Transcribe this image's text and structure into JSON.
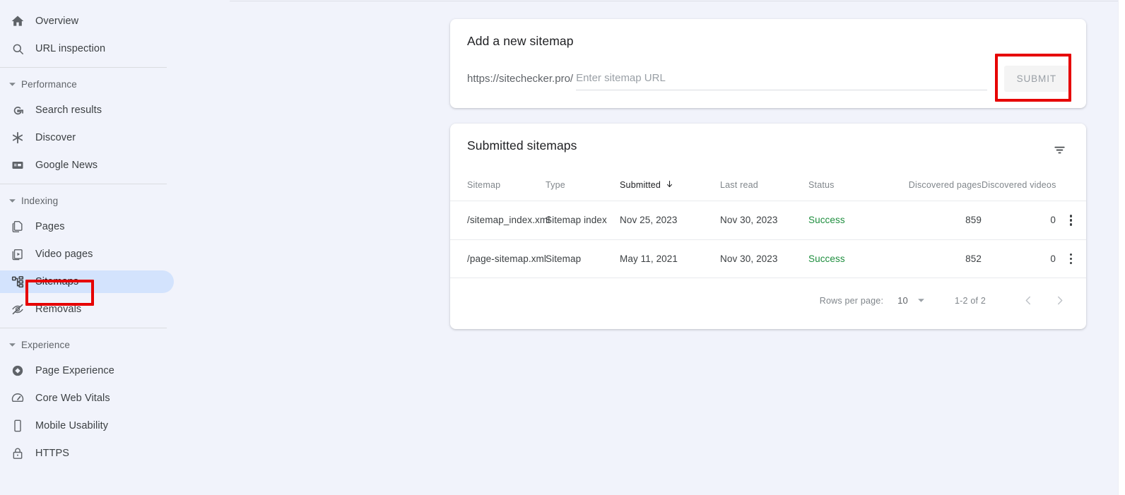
{
  "sidebar": {
    "top_items": [
      {
        "label": "Overview",
        "icon": "home-icon",
        "id": "overview"
      },
      {
        "label": "URL inspection",
        "icon": "search-icon",
        "id": "url-inspection"
      }
    ],
    "groups": [
      {
        "label": "Performance",
        "caret": "chevron-down-icon",
        "items": [
          {
            "label": "Search results",
            "icon": "google-g-icon",
            "id": "search-results"
          },
          {
            "label": "Discover",
            "icon": "asterisk-icon",
            "id": "discover"
          },
          {
            "label": "Google News",
            "icon": "news-card-icon",
            "id": "google-news"
          }
        ]
      },
      {
        "label": "Indexing",
        "caret": "chevron-down-icon",
        "items": [
          {
            "label": "Pages",
            "icon": "pages-copy-icon",
            "id": "pages"
          },
          {
            "label": "Video pages",
            "icon": "video-frame-icon",
            "id": "video-pages"
          },
          {
            "label": "Sitemaps",
            "icon": "sitemap-tree-icon",
            "id": "sitemaps",
            "active": true
          },
          {
            "label": "Removals",
            "icon": "eye-off-icon",
            "id": "removals"
          }
        ]
      },
      {
        "label": "Experience",
        "caret": "chevron-down-icon",
        "items": [
          {
            "label": "Page Experience",
            "icon": "diamond-circle-icon",
            "id": "page-experience"
          },
          {
            "label": "Core Web Vitals",
            "icon": "speedometer-icon",
            "id": "core-web-vitals"
          },
          {
            "label": "Mobile Usability",
            "icon": "mobile-phone-icon",
            "id": "mobile-usability"
          },
          {
            "label": "HTTPS",
            "icon": "lock-icon",
            "id": "https"
          }
        ]
      }
    ]
  },
  "add_sitemap": {
    "title": "Add a new sitemap",
    "url_prefix": "https://sitechecker.pro/",
    "input_value": "",
    "input_placeholder": "Enter sitemap URL",
    "submit_label": "SUBMIT",
    "submit_disabled": true
  },
  "submitted": {
    "title": "Submitted sitemaps",
    "filter_icon": "filter-list-icon",
    "columns": [
      {
        "key": "sitemap",
        "label": "Sitemap",
        "align": "left"
      },
      {
        "key": "type",
        "label": "Type",
        "align": "left"
      },
      {
        "key": "submitted",
        "label": "Submitted",
        "align": "left",
        "sorted": true,
        "sort_dir": "desc",
        "sort_icon": "arrow-down-icon"
      },
      {
        "key": "last_read",
        "label": "Last read",
        "align": "left"
      },
      {
        "key": "status",
        "label": "Status",
        "align": "left"
      },
      {
        "key": "discovered_pages",
        "label": "Discovered pages",
        "align": "right"
      },
      {
        "key": "discovered_videos",
        "label": "Discovered videos",
        "align": "right"
      }
    ],
    "rows": [
      {
        "sitemap": "/sitemap_index.xml",
        "type": "Sitemap index",
        "submitted": "Nov 25, 2023",
        "last_read": "Nov 30, 2023",
        "status": "Success",
        "discovered_pages": "859",
        "discovered_videos": "0",
        "menu_icon": "more-vert-icon"
      },
      {
        "sitemap": "/page-sitemap.xml",
        "type": "Sitemap",
        "submitted": "May 11, 2021",
        "last_read": "Nov 30, 2023",
        "status": "Success",
        "discovered_pages": "852",
        "discovered_videos": "0",
        "menu_icon": "more-vert-icon"
      }
    ],
    "pagination": {
      "rows_per_page_label": "Rows per page:",
      "rows_per_page_value": "10",
      "caret_icon": "chevron-down-icon",
      "range": "1-2 of 2",
      "prev_icon": "chevron-left-icon",
      "next_icon": "chevron-right-icon"
    }
  },
  "annotations": {
    "highlight_color": "#e60000",
    "boxes": [
      "sitemaps-nav-item",
      "submit-button"
    ]
  },
  "colors": {
    "page_bg": "#f1f3fb",
    "card_bg": "#ffffff",
    "active_nav_bg": "#d3e3fd",
    "status_success": "#1e8e3e",
    "text_primary": "#202124",
    "text_secondary": "#5f6368",
    "text_muted": "#80868b"
  }
}
